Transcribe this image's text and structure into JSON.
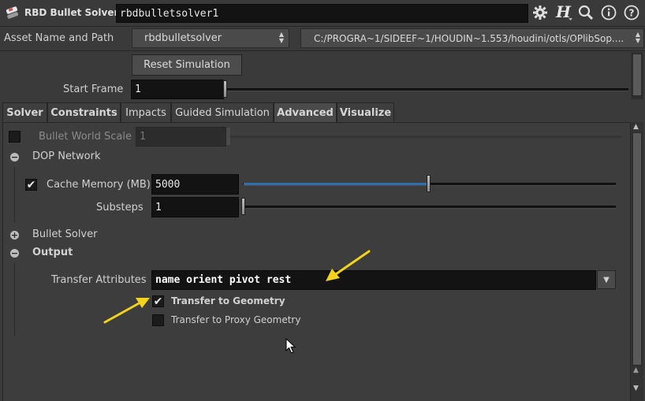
{
  "header": {
    "node_type": "RBD Bullet Solver",
    "node_name": "rbdbulletsolver1"
  },
  "asset": {
    "label": "Asset Name and Path",
    "name": "rbdbulletsolver",
    "path": "C:/PROGRA~1/SIDEEF~1/HOUDIN~1.553/houdini/otls/OPlibSop...."
  },
  "controls": {
    "reset_label": "Reset Simulation",
    "start_frame_label": "Start Frame",
    "start_frame_value": "1"
  },
  "tabs": [
    "Solver",
    "Constraints",
    "Impacts",
    "Guided Simulation",
    "Advanced",
    "Visualize"
  ],
  "advanced": {
    "world_scale_label": "Bullet World Scale",
    "world_scale_value": "1",
    "dop_network_label": "DOP Network",
    "cache_memory_label": "Cache Memory (MB)",
    "cache_memory_value": "5000",
    "substeps_label": "Substeps",
    "substeps_value": "1",
    "bullet_solver_label": "Bullet Solver",
    "output_label": "Output",
    "transfer_attr_label": "Transfer Attributes",
    "transfer_attr_value": "name orient pivot rest",
    "transfer_geo_label": "Transfer to Geometry",
    "transfer_proxy_label": "Transfer to Proxy Geometry"
  },
  "colors": {
    "annotation_arrow": "#f2d21b",
    "accent_slider": "#2f6fae"
  }
}
